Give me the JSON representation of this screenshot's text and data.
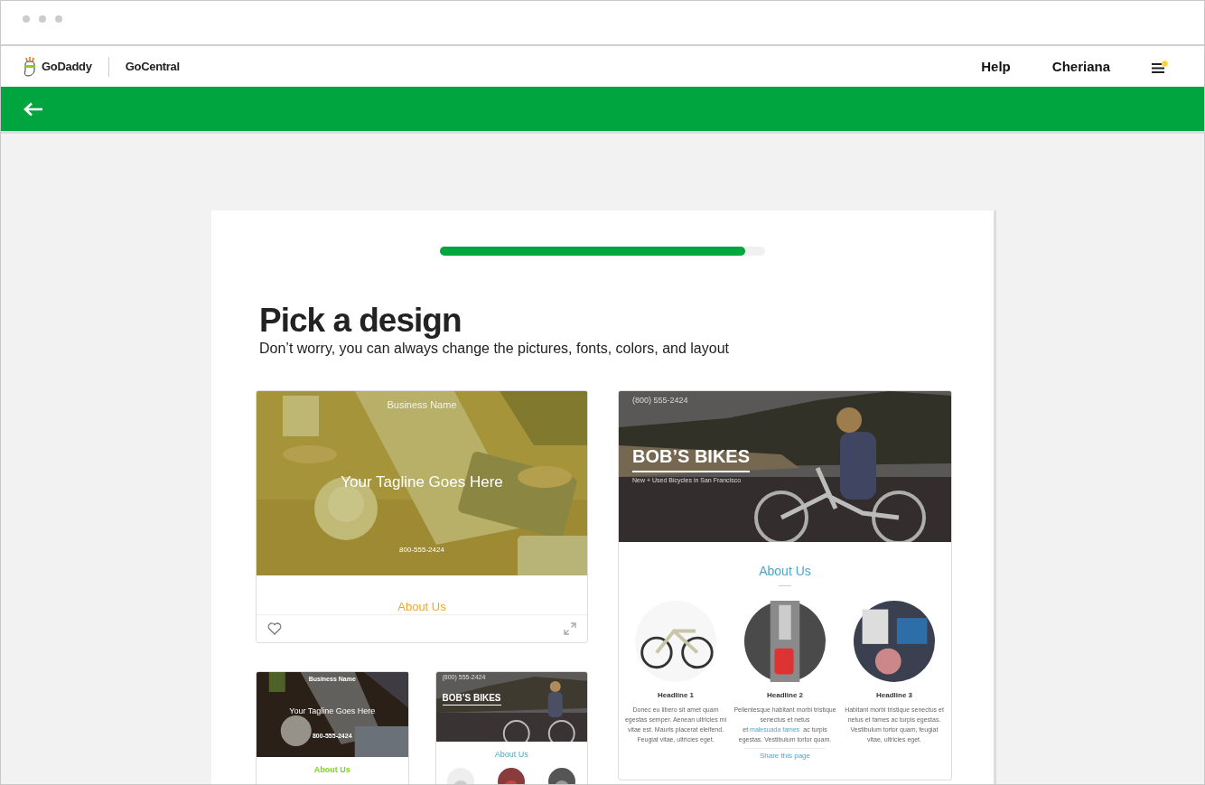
{
  "header": {
    "brand": "GoDaddy",
    "product": "GoCentral",
    "nav": [
      "Help",
      "Cheriana"
    ],
    "menu_notification": true
  },
  "progress": {
    "level": 0.94
  },
  "heading": "Pick a design",
  "subheading": "Don’t worry, you can always change the pictures, fonts, colors, and layout",
  "templates": [
    {
      "kind": "business",
      "business_name": "Business Name",
      "tagline": "Your Tagline Goes Here",
      "phone": "800-555-2424",
      "section_title": "About Us",
      "color": "#f5a623",
      "favorite": false
    },
    {
      "kind": "bikes",
      "phone": "(800) 555-2424",
      "title": "BOB’S BIKES",
      "subtitle": "New + Used Bicycles in San Francisco",
      "section_title": "About Us",
      "features": [
        {
          "headline": "Headline 1",
          "text": "Donec eu libero sit amet quam egestas semper. Aenean ultricies mi vitae est. Mauris placerat eleifend. Feugiat vitae, ultricies eget."
        },
        {
          "headline": "Headline 2",
          "text": "Pellentesque habitant morbi tristique senectus et netus et",
          "link": "malesuada fames",
          "text_after": "ac turpis egestas. Vestibulum tortor quam."
        },
        {
          "headline": "Headline 3",
          "text": "Habitant morbi tristique senectus et netus et fames ac turpis egestas. Vestibulum tortor quam, feugiat vitae, ultricies eget."
        }
      ],
      "link": "Share this page"
    }
  ],
  "more_templates": [
    {
      "kind": "business",
      "business_name": "Business Name",
      "tagline": "Your Tagline Goes Here",
      "phone": "800-555-2424",
      "section_title": "About Us",
      "color": "#7ed321"
    },
    {
      "kind": "bikes",
      "phone": "(800) 555-2424",
      "title": "BOB’S BIKES",
      "section_title": "About Us"
    }
  ]
}
